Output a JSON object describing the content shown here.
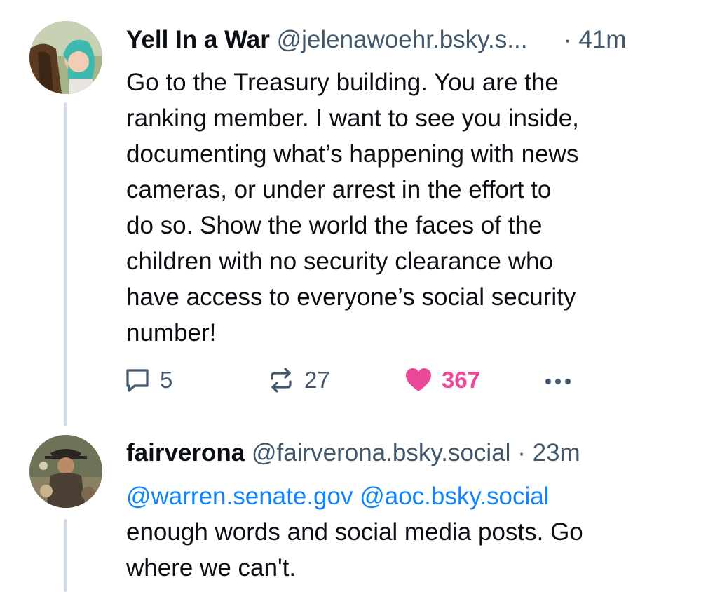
{
  "posts": [
    {
      "author_name": "Yell In a War",
      "handle": "@jelenawoehr.bsky.s...",
      "separator": "·",
      "time": "41m",
      "text_lines": [
        "Go to the Treasury building. You are the",
        "ranking member. I want to see you inside,",
        "documenting what’s happening with news",
        "cameras, or under arrest in the effort to",
        "do so. Show the world the faces of the",
        "children with no security clearance who",
        "have access to everyone’s social security",
        "number!"
      ],
      "reply_count": "5",
      "repost_count": "27",
      "like_count": "367",
      "avatar_icon": "avatar-woman-with-horse",
      "reply_icon": "speech-bubble-icon",
      "repost_icon": "repost-arrows-icon",
      "like_icon": "heart-filled-icon",
      "more_icon": "ellipsis-icon"
    },
    {
      "author_name": "fairverona",
      "handle": "@fairverona.bsky.social",
      "separator": "·",
      "time": "23m",
      "mentions": "@warren.senate.gov @aoc.bsky.social",
      "text_lines": [
        "enough words and social media posts. Go",
        "where we can't."
      ],
      "avatar_icon": "avatar-man-in-hat"
    }
  ],
  "colors": {
    "text": "#0b0f14",
    "muted": "#42576c",
    "link": "#1083fe",
    "like": "#ec4899",
    "thread_line": "#d4dbe2"
  }
}
